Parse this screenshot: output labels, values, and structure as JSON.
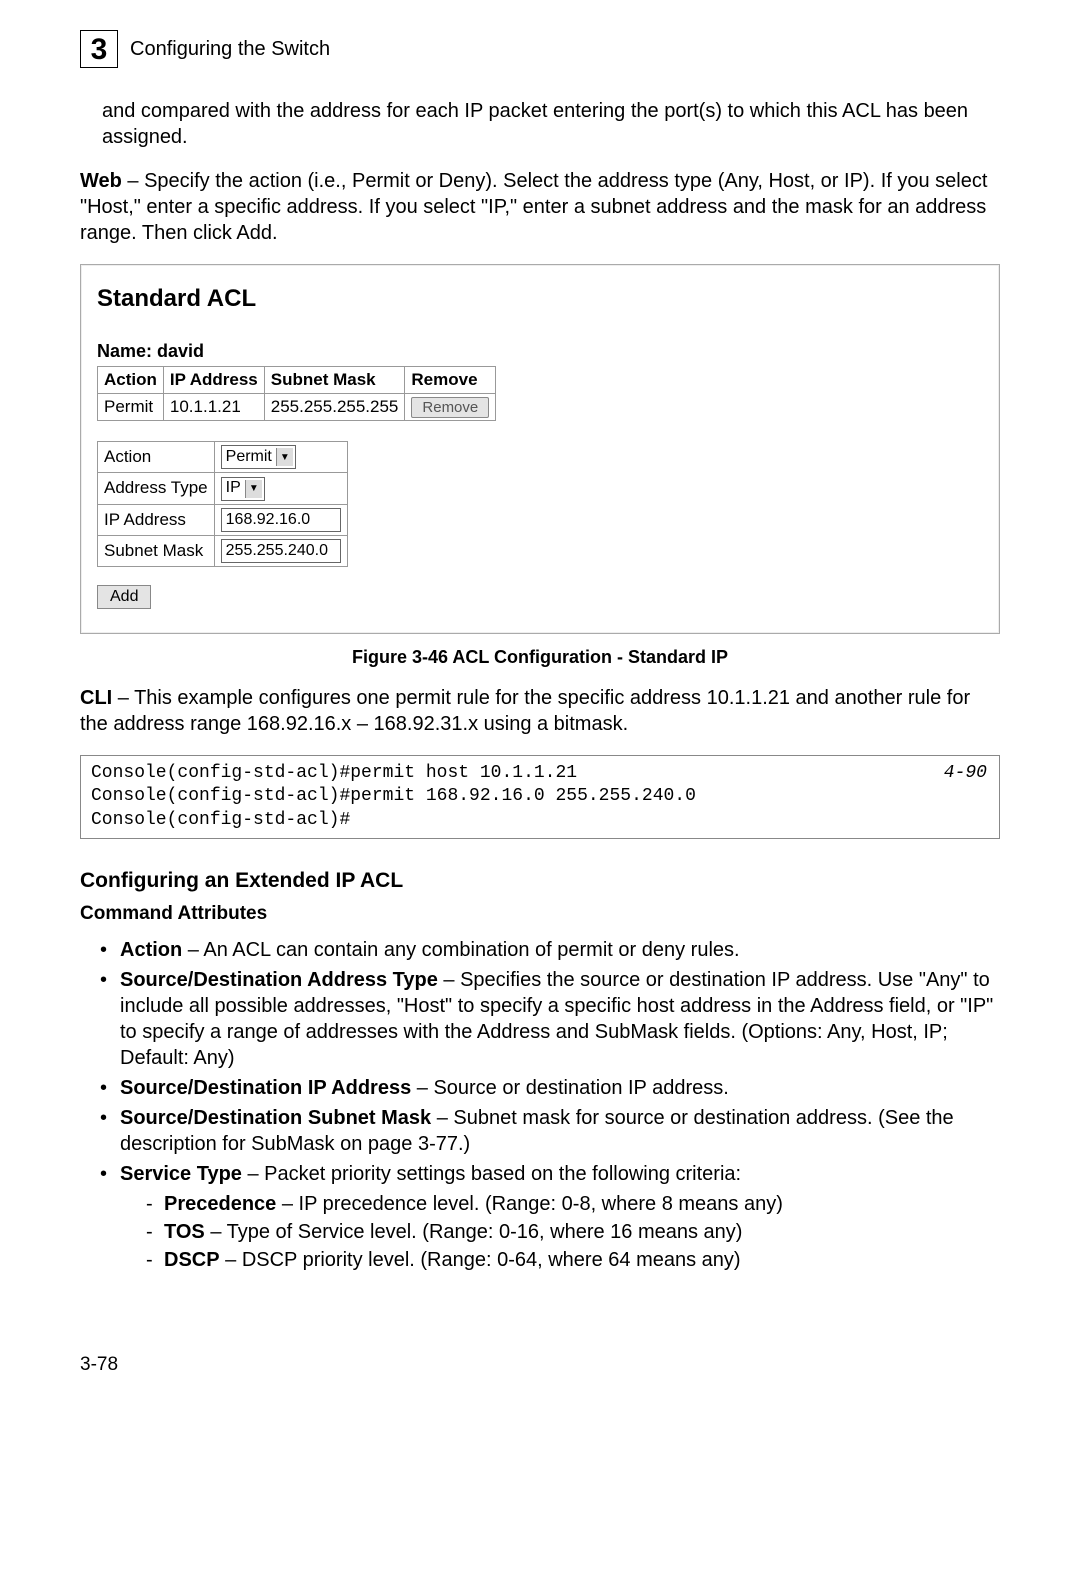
{
  "header": {
    "chapter_number": "3",
    "chapter_title": "Configuring the Switch"
  },
  "intro_para": "and compared with the address for each IP packet entering the port(s) to which this ACL has been assigned.",
  "web_label": "Web",
  "web_para": " – Specify the action (i.e., Permit or Deny). Select the address type (Any, Host, or IP). If you select \"Host,\" enter a specific address. If you select \"IP,\" enter a subnet address and the mask for an address range. Then click Add.",
  "panel": {
    "title": "Standard ACL",
    "name_label": "Name: david",
    "columns": {
      "c1": "Action",
      "c2": "IP Address",
      "c3": "Subnet Mask",
      "c4": "Remove"
    },
    "row": {
      "action": "Permit",
      "ip": "10.1.1.21",
      "mask": "255.255.255.255",
      "remove": "Remove"
    },
    "form": {
      "action_label": "Action",
      "action_value": "Permit",
      "addrtype_label": "Address Type",
      "addrtype_value": "IP",
      "ip_label": "IP Address",
      "ip_value": "168.92.16.0",
      "mask_label": "Subnet Mask",
      "mask_value": "255.255.240.0"
    },
    "add_label": "Add"
  },
  "figure_caption": "Figure 3-46   ACL Configuration - Standard IP",
  "cli_label": "CLI",
  "cli_para": " – This example configures one permit rule for the specific address 10.1.1.21 and another rule for the address range 168.92.16.x – 168.92.31.x using a bitmask.",
  "cli_block": {
    "line1": "Console(config-std-acl)#permit host 10.1.1.21",
    "line2": "Console(config-std-acl)#permit 168.92.16.0 255.255.240.0",
    "line3": "Console(config-std-acl)#",
    "ref": "4-90"
  },
  "ext_heading": "Configuring an Extended IP ACL",
  "cmd_attr_heading": "Command Attributes",
  "attrs": {
    "action_b": "Action",
    "action_t": " –  An ACL can contain any combination of permit or deny rules.",
    "addr_b": "Source/Destination Address Type",
    "addr_t": " – Specifies the source or destination IP address. Use \"Any\" to include all possible addresses, \"Host\" to specify a specific host address in the Address field, or \"IP\" to specify a range of addresses with the Address and SubMask fields. (Options: Any, Host, IP; Default: Any)",
    "ip_b": "Source/Destination IP Address",
    "ip_t": " – Source or destination IP address.",
    "mask_b": "Source/Destination Subnet Mask",
    "mask_t": " – Subnet mask for source or destination address. (See the description for SubMask on page 3-77.)",
    "svc_b": "Service Type",
    "svc_t": " – Packet priority settings based on the following criteria:",
    "prec_b": "Precedence",
    "prec_t": " – IP precedence level. (Range: 0-8, where 8 means any)",
    "tos_b": "TOS",
    "tos_t": " – Type of Service level. (Range: 0-16, where 16 means any)",
    "dscp_b": "DSCP",
    "dscp_t": " – DSCP priority level. (Range: 0-64, where 64 means any)"
  },
  "page_number": "3-78"
}
